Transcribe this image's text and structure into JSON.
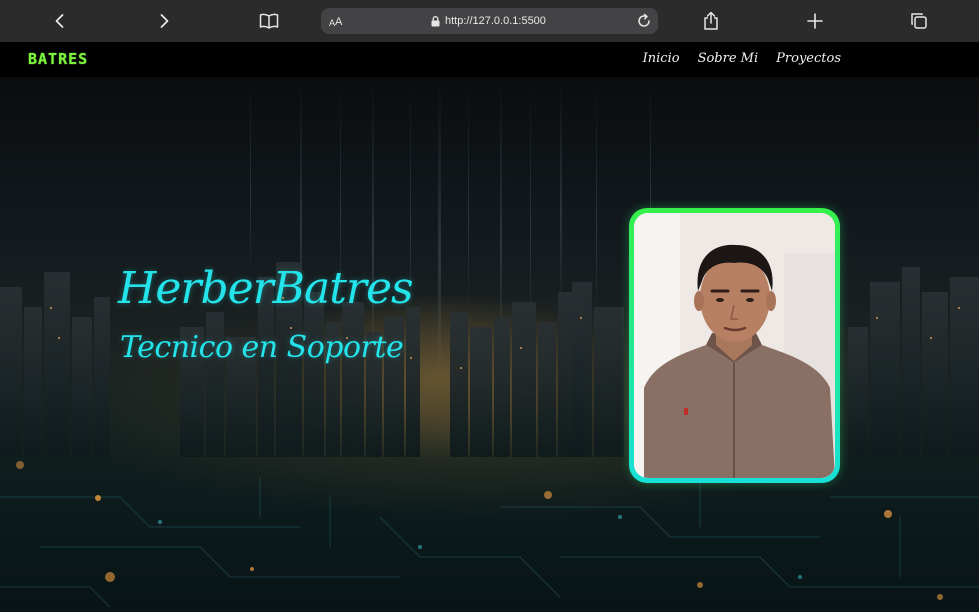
{
  "browser": {
    "text_size_small": "A",
    "text_size_big": "A",
    "url": "http://127.0.0.1:5500",
    "icons": [
      "back-icon",
      "forward-icon",
      "bookmarks-icon",
      "lock-icon",
      "reload-icon",
      "share-icon",
      "new-tab-icon",
      "tabs-icon"
    ]
  },
  "site": {
    "logo": "BATRES",
    "nav": [
      {
        "label": "Inicio"
      },
      {
        "label": "Sobre Mi"
      },
      {
        "label": "Proyectos"
      }
    ]
  },
  "hero": {
    "name": "HerberBatres",
    "role": "Tecnico en Soporte"
  },
  "colors": {
    "accent_cyan": "#23e4ea",
    "logo_green": "#7cf33d",
    "frame_green": "#36f04a",
    "nav_bg": "#000000",
    "browser_bg": "#2b2b2c"
  }
}
